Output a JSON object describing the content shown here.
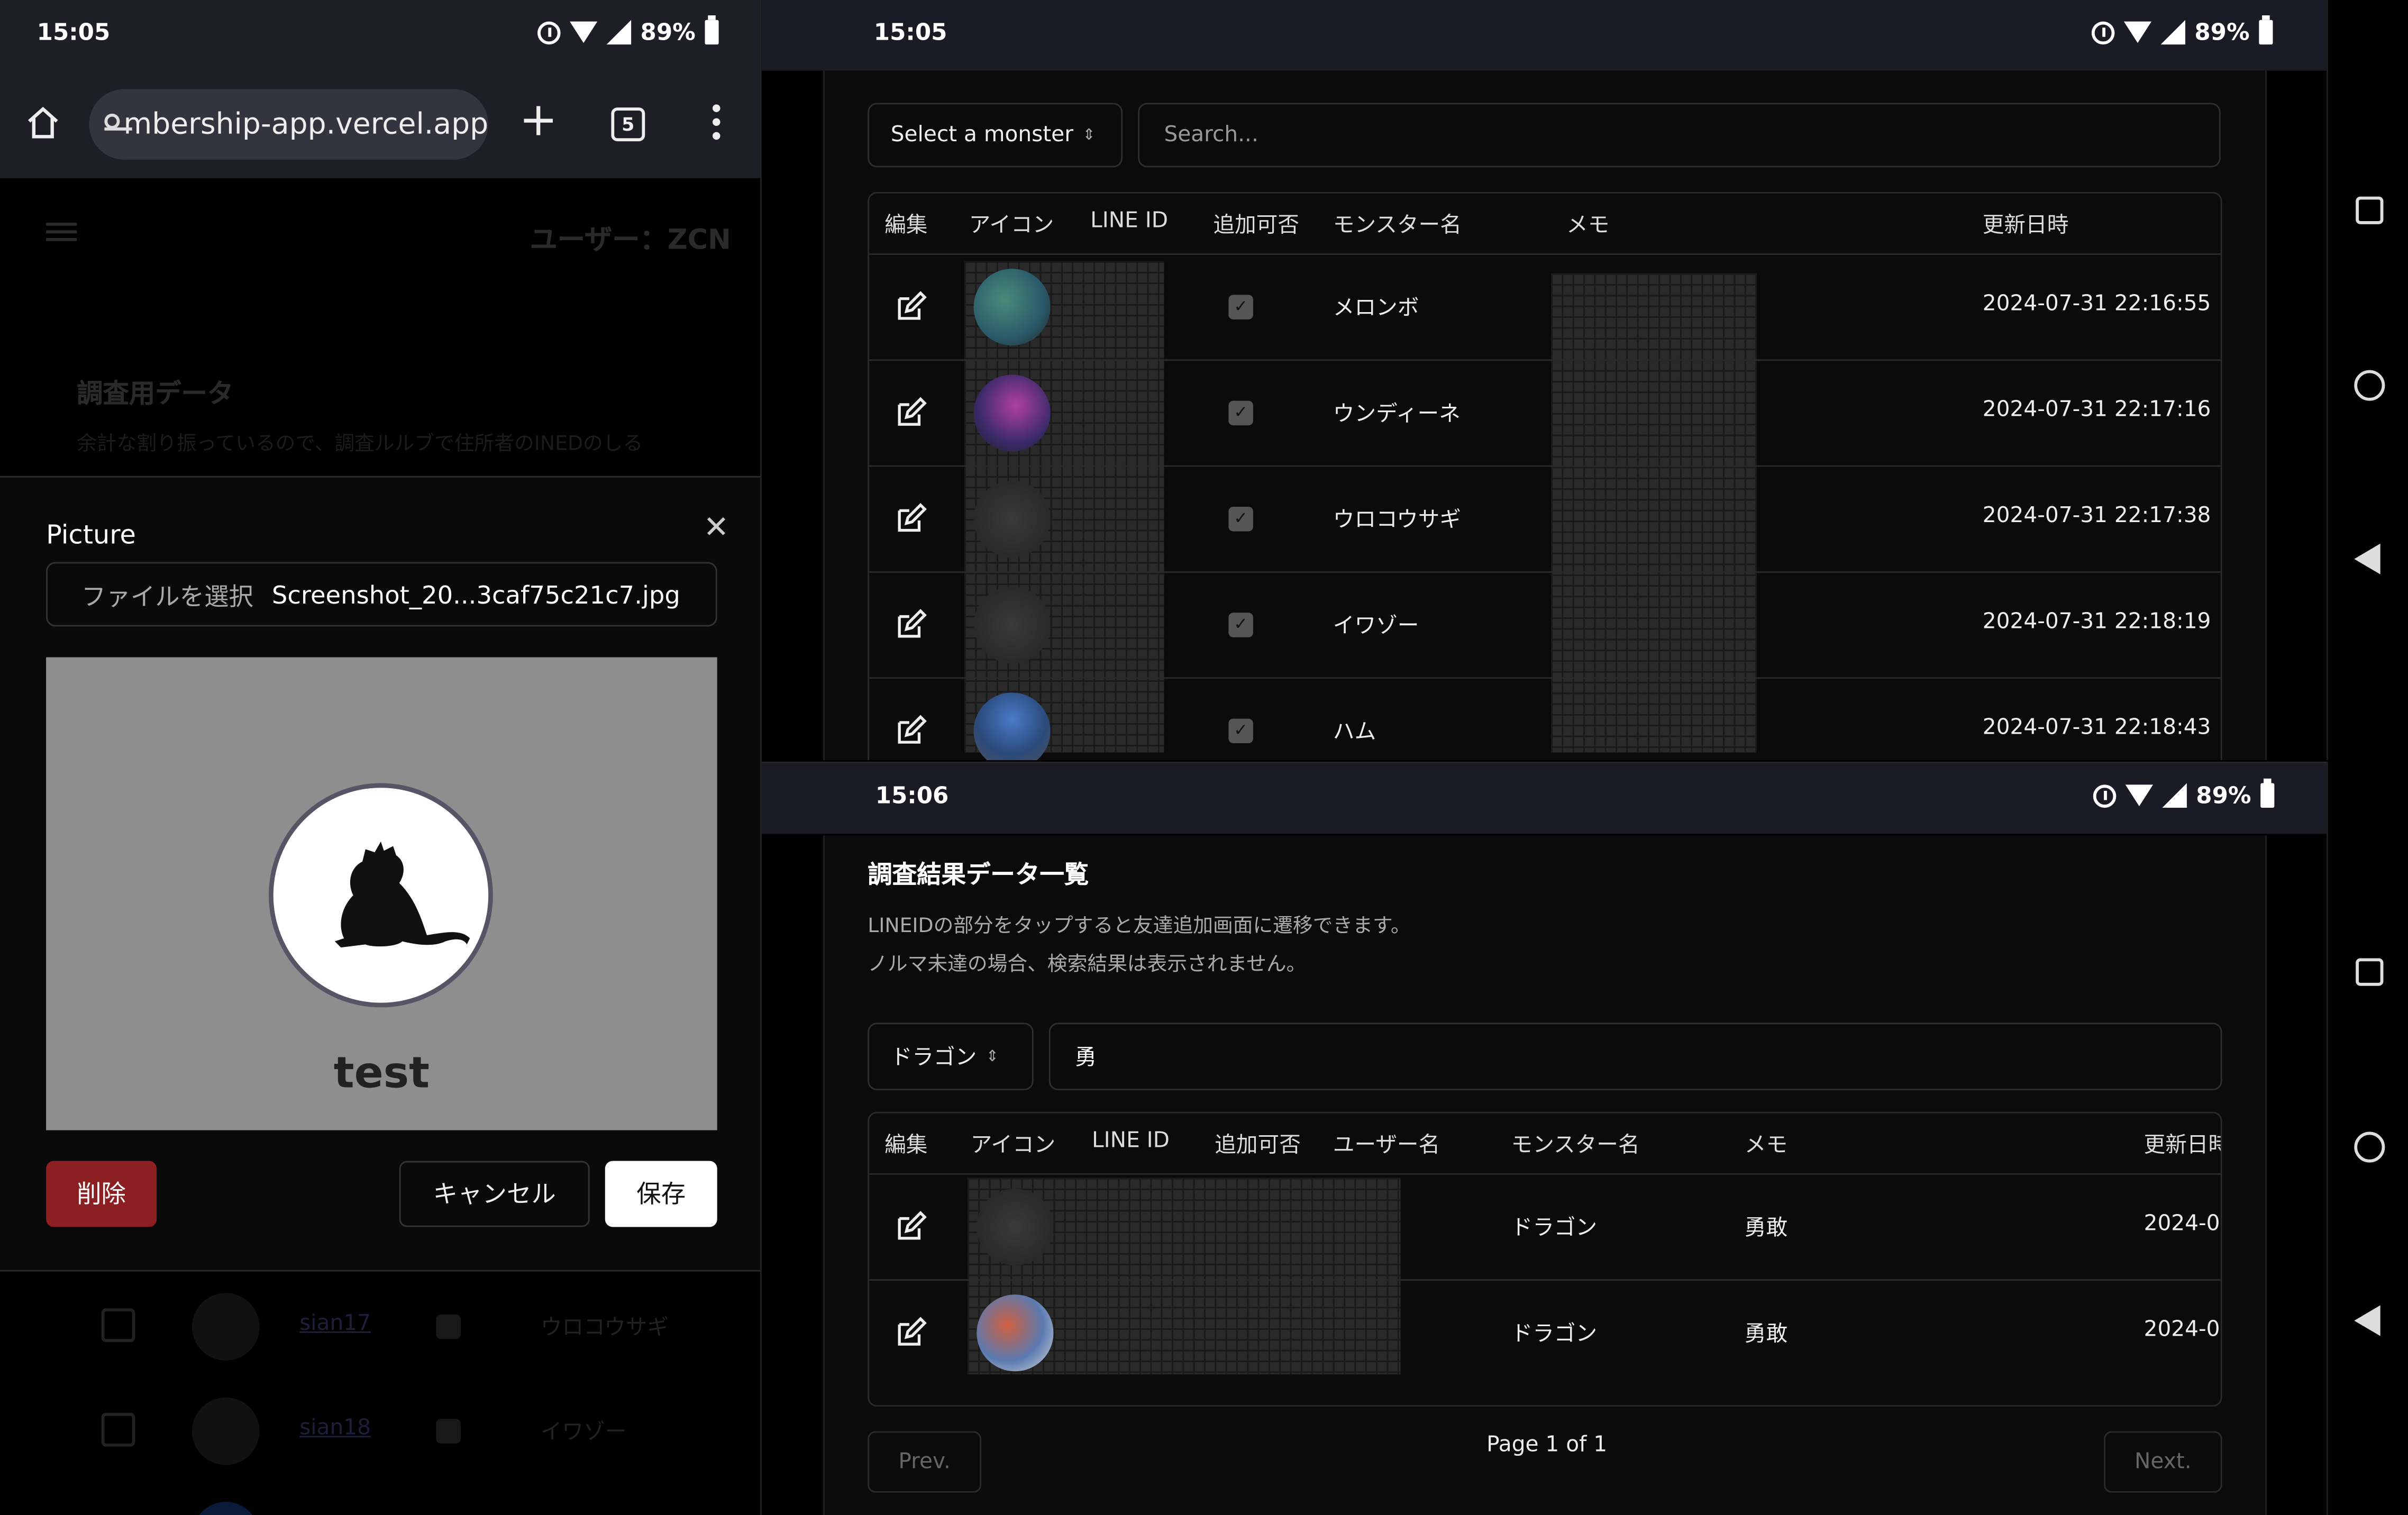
{
  "status_left": {
    "time": "15:05",
    "battery": "89%"
  },
  "status_right_top": {
    "time": "15:05",
    "battery": "89%"
  },
  "status_right_bottom": {
    "time": "15:06",
    "battery": "89%"
  },
  "browser": {
    "url": "mbership-app.vercel.app",
    "tab_count": "5"
  },
  "background_page": {
    "user_label": "ユーザー：ZCN",
    "section_title": "調査用データ",
    "section_desc": "余計な割り振っているので、調査ルルブで住所者のINEDのしる",
    "bg_rows": [
      {
        "line_id": "sian17",
        "monster": "ウロコウサギ"
      },
      {
        "line_id": "sian18",
        "monster": "イワゾー"
      }
    ]
  },
  "modal": {
    "title": "Picture",
    "file_button": "ファイルを選択",
    "file_name": "Screenshot_20...3caf75c21c7.jpg",
    "preview_name": "test",
    "delete_label": "削除",
    "cancel_label": "キャンセル",
    "save_label": "保存"
  },
  "top_table": {
    "select_label": "Select a monster",
    "search_placeholder": "Search...",
    "headers": {
      "edit": "編集",
      "icon": "アイコン",
      "line_id": "LINE ID",
      "addable": "追加可否",
      "monster": "モンスター名",
      "memo": "メモ",
      "updated": "更新日時"
    },
    "rows": [
      {
        "monster": "メロンボ",
        "updated": "2024-07-31 22:16:55",
        "checked": true
      },
      {
        "monster": "ウンディーネ",
        "updated": "2024-07-31 22:17:16",
        "checked": true
      },
      {
        "monster": "ウロコウサギ",
        "updated": "2024-07-31 22:17:38",
        "checked": true
      },
      {
        "monster": "イワゾー",
        "updated": "2024-07-31 22:18:19",
        "checked": true
      },
      {
        "monster": "ハム",
        "updated": "2024-07-31 22:18:43",
        "checked": true
      }
    ]
  },
  "bottom": {
    "title": "調査結果データ一覧",
    "desc1": "LINEIDの部分をタップすると友達追加画面に遷移できます。",
    "desc2": "ノルマ未達の場合、検索結果は表示されません。",
    "select_label": "ドラゴン",
    "search_value": "勇",
    "headers": {
      "edit": "編集",
      "icon": "アイコン",
      "line_id": "LINE ID",
      "addable": "追加可否",
      "username": "ユーザー名",
      "monster": "モンスター名",
      "memo": "メモ",
      "updated": "更新日時"
    },
    "rows": [
      {
        "monster": "ドラゴン",
        "memo": "勇敢",
        "updated": "2024-0"
      },
      {
        "monster": "ドラゴン",
        "memo": "勇敢",
        "updated": "2024-0"
      }
    ],
    "prev_label": "Prev.",
    "page_label": "Page 1 of 1",
    "next_label": "Next."
  }
}
